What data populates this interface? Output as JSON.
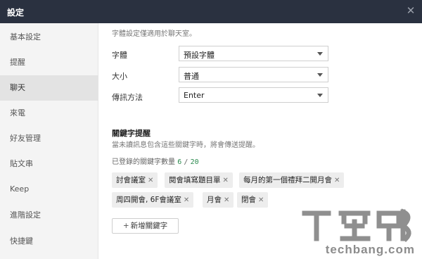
{
  "window": {
    "title": "設定",
    "close_icon": "close-icon"
  },
  "sidebar": {
    "items": [
      {
        "label": "基本設定"
      },
      {
        "label": "提醒"
      },
      {
        "label": "聊天",
        "active": true
      },
      {
        "label": "來電"
      },
      {
        "label": "好友管理"
      },
      {
        "label": "貼文串"
      },
      {
        "label": "Keep"
      },
      {
        "label": "進階設定"
      },
      {
        "label": "快捷鍵"
      }
    ]
  },
  "font_settings": {
    "description": "字體設定僅適用於聊天室。",
    "font_label": "字體",
    "font_value": "預設字體",
    "size_label": "大小",
    "size_value": "普通",
    "send_label": "傳訊方法",
    "send_value": "Enter"
  },
  "keyword_alert": {
    "title": "關鍵字提醒",
    "description": "當未讀訊息包含這些關鍵字時，將會傳送提醒。",
    "count_label": "已登錄的關鍵字數量",
    "count_current": "6",
    "count_separator": "/",
    "count_max": "20",
    "keywords": [
      "討會議室",
      "閱會填寫題目單",
      "每月的第一個禮拜二開月會",
      "周四開會, 6F會議室",
      "月會",
      "閉會"
    ],
    "add_button_label": "新增關鍵字"
  },
  "watermark": {
    "text": "techbang.com"
  }
}
